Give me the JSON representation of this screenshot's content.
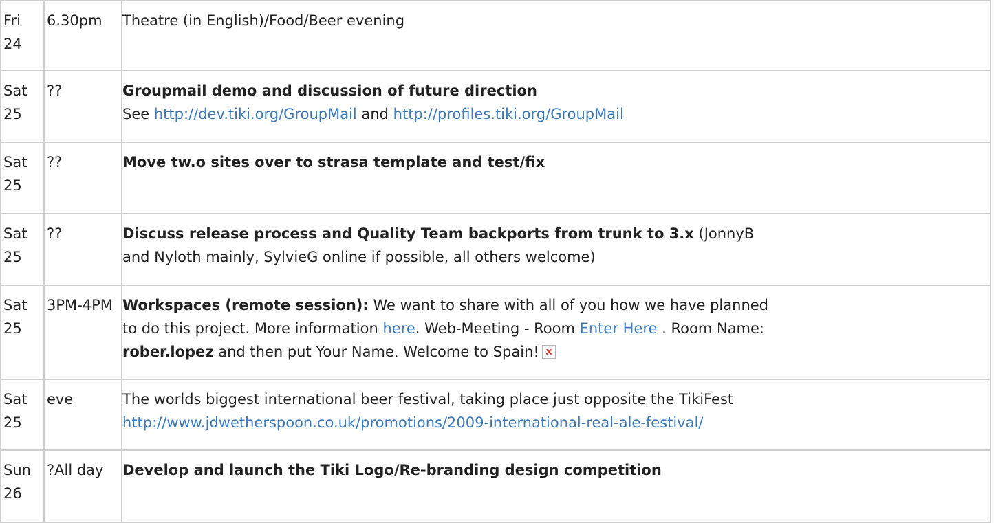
{
  "rows": [
    {
      "day": "Fri",
      "date": "24",
      "time": "6.30pm",
      "text": "Theatre (in English)/Food/Beer evening"
    },
    {
      "day": "Sat",
      "date": "25",
      "time": "??",
      "title": "Groupmail demo and discussion of future direction",
      "see_label": "See",
      "link1": "http://dev.tiki.org/GroupMail",
      "and_label": "and",
      "link2": "http://profiles.tiki.org/GroupMail"
    },
    {
      "day": "Sat",
      "date": "25",
      "time": "??",
      "title": "Move tw.o sites over to strasa template and test/fix"
    },
    {
      "day": "Sat",
      "date": "25",
      "time": "??",
      "title": "Discuss release process and Quality Team backports from trunk to 3.x",
      "line1_rest": "(JonnyB",
      "line2": "and Nyloth mainly, SylvieG online if possible, all others welcome)"
    },
    {
      "day": "Sat",
      "date": "25",
      "time": "3PM-4PM",
      "title": "Workspaces (remote session):",
      "line1_rest": "We want to share with all of you how we have planned",
      "line2_a": "to do this project. More information",
      "link_here": "here",
      "line2_b": ". Web-Meeting - Room",
      "link_enter": "Enter Here",
      "line2_c": ". Room Name:",
      "room_name": "rober.lopez",
      "line3_rest": "and then put Your Name. Welcome to Spain!",
      "image_icon": "broken-image-icon"
    },
    {
      "day": "Sat",
      "date": "25",
      "time": "eve",
      "text": "The worlds biggest international beer festival, taking place just opposite the TikiFest",
      "link": "http://www.jdwetherspoon.co.uk/promotions/2009-international-real-ale-festival/"
    },
    {
      "day": "Sun",
      "date": "26",
      "time": "?All day",
      "title": "Develop and launch the Tiki Logo/Re-branding design competition"
    }
  ]
}
